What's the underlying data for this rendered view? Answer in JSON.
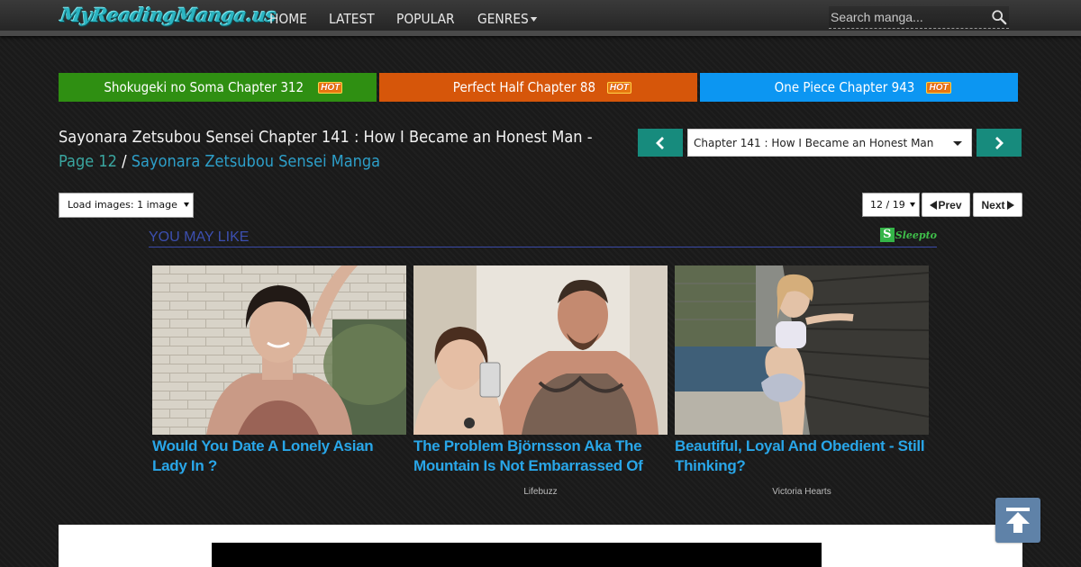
{
  "site": {
    "logo_text": "MyReadingManga.us"
  },
  "nav": {
    "items": [
      {
        "label": "HOME"
      },
      {
        "label": "LATEST"
      },
      {
        "label": "POPULAR"
      },
      {
        "label": "GENRES"
      }
    ],
    "search_placeholder": "Search manga..."
  },
  "hot_bars": [
    {
      "label": "Shokugeki no Soma Chapter 312",
      "badge": "HOT",
      "color": "#2f8f12"
    },
    {
      "label": "Perfect Half Chapter 88",
      "badge": "HOT",
      "color": "#d6560a"
    },
    {
      "label": "One Piece Chapter 943",
      "badge": "HOT",
      "color": "#0c96f2"
    }
  ],
  "title": {
    "main": "Sayonara Zetsubou Sensei Chapter 141 : How I Became an Honest Man -",
    "page_link": "Page 12",
    "separator": "/",
    "manga_link": "Sayonara Zetsubou Sensei Manga"
  },
  "chapter_nav": {
    "selected": "Chapter 141 : How I Became an Honest Man"
  },
  "reader_controls": {
    "load_images": "Load images: 1 image",
    "page_select": "12 / 19",
    "prev_label": "Prev",
    "next_label": "Next"
  },
  "you_may_like": {
    "heading": "YOU MAY LIKE",
    "sponsor": "Sleepto",
    "sponsor_initial": "S",
    "cards": [
      {
        "caption": "Would You Date A Lonely Asian Lady In ?",
        "source": ""
      },
      {
        "caption": "The Problem Björnsson Aka The Mountain Is Not Embarrassed Of",
        "source": "Lifebuzz"
      },
      {
        "caption": "Beautiful, Loyal And Obedient - Still Thinking?",
        "source": "Victoria Hearts"
      }
    ]
  },
  "colors": {
    "teal_button": "#178b7d",
    "link_blue": "#2d9fc9",
    "ad_caption": "#29a6e8",
    "heading_blue": "#3c4fb0"
  },
  "icons": {
    "search": "search-icon",
    "chapter_prev": "chevron-left-icon",
    "chapter_next": "chevron-right-icon",
    "back_to_top": "arrow-up-icon"
  }
}
